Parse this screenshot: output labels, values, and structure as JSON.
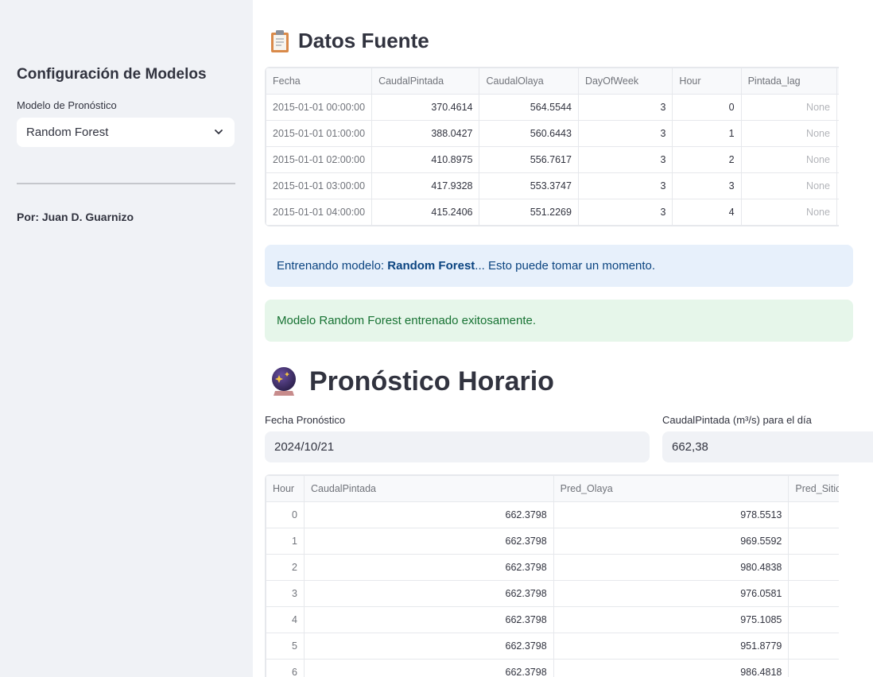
{
  "sidebar": {
    "title": "Configuración de Modelos",
    "model_label": "Modelo de Pronóstico",
    "model_value": "Random Forest",
    "author": "Por: Juan D. Guarnizo"
  },
  "source": {
    "title": "Datos Fuente",
    "icon": "clipboard-icon",
    "columns": [
      "Fecha",
      "CaudalPintada",
      "CaudalOlaya",
      "DayOfWeek",
      "Hour",
      "Pintada_lag"
    ],
    "rows": [
      [
        "2015-01-01 00:00:00",
        "370.4614",
        "564.5544",
        "3",
        "0",
        "None"
      ],
      [
        "2015-01-01 01:00:00",
        "388.0427",
        "560.6443",
        "3",
        "1",
        "None"
      ],
      [
        "2015-01-01 02:00:00",
        "410.8975",
        "556.7617",
        "3",
        "2",
        "None"
      ],
      [
        "2015-01-01 03:00:00",
        "417.9328",
        "553.3747",
        "3",
        "3",
        "None"
      ],
      [
        "2015-01-01 04:00:00",
        "415.2406",
        "551.2269",
        "3",
        "4",
        "None"
      ]
    ]
  },
  "alerts": {
    "info_prefix": "Entrenando modelo: ",
    "info_model": "Random Forest",
    "info_suffix": "... Esto puede tomar un momento.",
    "success": "Modelo Random Forest entrenado exitosamente."
  },
  "forecast": {
    "title": "Pronóstico Horario",
    "icon": "crystal-ball-icon",
    "date_label": "Fecha Pronóstico",
    "date_value": "2024/10/21",
    "flow_label": "CaudalPintada (m³/s) para el día",
    "flow_value": "662,38",
    "columns": [
      "Hour",
      "CaudalPintada",
      "Pred_Olaya",
      "Pred_Sitio"
    ],
    "rows": [
      [
        "0",
        "662.3798",
        "978.5513"
      ],
      [
        "1",
        "662.3798",
        "969.5592"
      ],
      [
        "2",
        "662.3798",
        "980.4838"
      ],
      [
        "3",
        "662.3798",
        "976.0581"
      ],
      [
        "4",
        "662.3798",
        "975.1085"
      ],
      [
        "5",
        "662.3798",
        "951.8779"
      ],
      [
        "6",
        "662.3798",
        "986.4818"
      ]
    ]
  }
}
